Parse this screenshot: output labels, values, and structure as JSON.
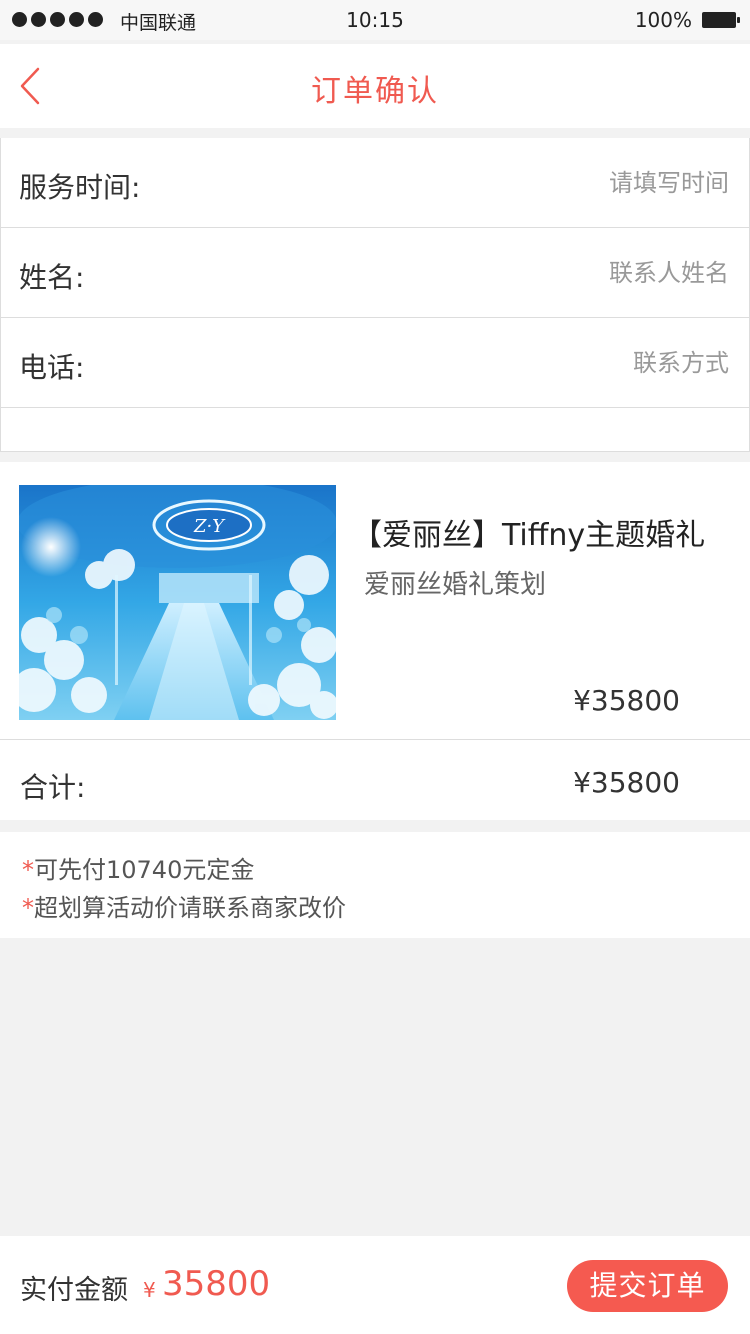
{
  "status_bar": {
    "carrier": "中国联通",
    "time": "10:15",
    "battery": "100%"
  },
  "nav": {
    "title": "订单确认",
    "back_icon": "chevron-left-icon"
  },
  "form": {
    "service_time": {
      "label": "服务时间:",
      "placeholder": "请填写时间",
      "value": ""
    },
    "name": {
      "label": "姓名:",
      "placeholder": "联系人姓名",
      "value": ""
    },
    "phone": {
      "label": "电话:",
      "placeholder": "联系方式",
      "value": ""
    }
  },
  "product": {
    "title": "【爱丽丝】Tiffny主题婚礼",
    "subtitle": "爱丽丝婚礼策划",
    "price": "¥35800",
    "image_icon": "wedding-venue-photo"
  },
  "total": {
    "label": "合计:",
    "amount": "¥35800"
  },
  "notes": [
    {
      "star": "*",
      "text": "可先付10740元定金"
    },
    {
      "star": "*",
      "text": "超划算活动价请联系商家改价"
    }
  ],
  "footer": {
    "pay_label": "实付金额",
    "currency": "¥",
    "amount": "35800",
    "submit_label": "提交订单"
  },
  "colors": {
    "accent": "#f05a50",
    "background": "#f2f2f2",
    "text": "#333333"
  }
}
